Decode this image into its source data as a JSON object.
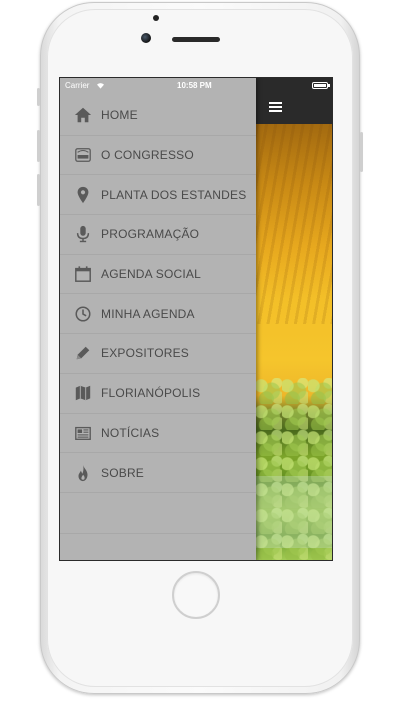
{
  "status_bar": {
    "carrier": "Carrier",
    "time": "10:58 PM"
  },
  "menu": {
    "items": [
      {
        "label": "HOME",
        "icon": "home-icon"
      },
      {
        "label": "O CONGRESSO",
        "icon": "soja-logo-icon"
      },
      {
        "label": "PLANTA DOS ESTANDES",
        "icon": "map-pin-icon"
      },
      {
        "label": "PROGRAMAÇÃO",
        "icon": "microphone-icon"
      },
      {
        "label": "AGENDA SOCIAL",
        "icon": "calendar-icon"
      },
      {
        "label": "MINHA AGENDA",
        "icon": "clock-icon"
      },
      {
        "label": "EXPOSITORES",
        "icon": "pencil-icon"
      },
      {
        "label": "FLORIANÓPOLIS",
        "icon": "map-icon"
      },
      {
        "label": "NOTÍCIAS",
        "icon": "newspaper-icon"
      },
      {
        "label": "SOBRE",
        "icon": "flame-icon"
      }
    ]
  },
  "colors": {
    "drawer_bg": "#b3b3b3",
    "menu_text": "#4a4a4a",
    "navbar_bg": "#2a2a2a"
  }
}
